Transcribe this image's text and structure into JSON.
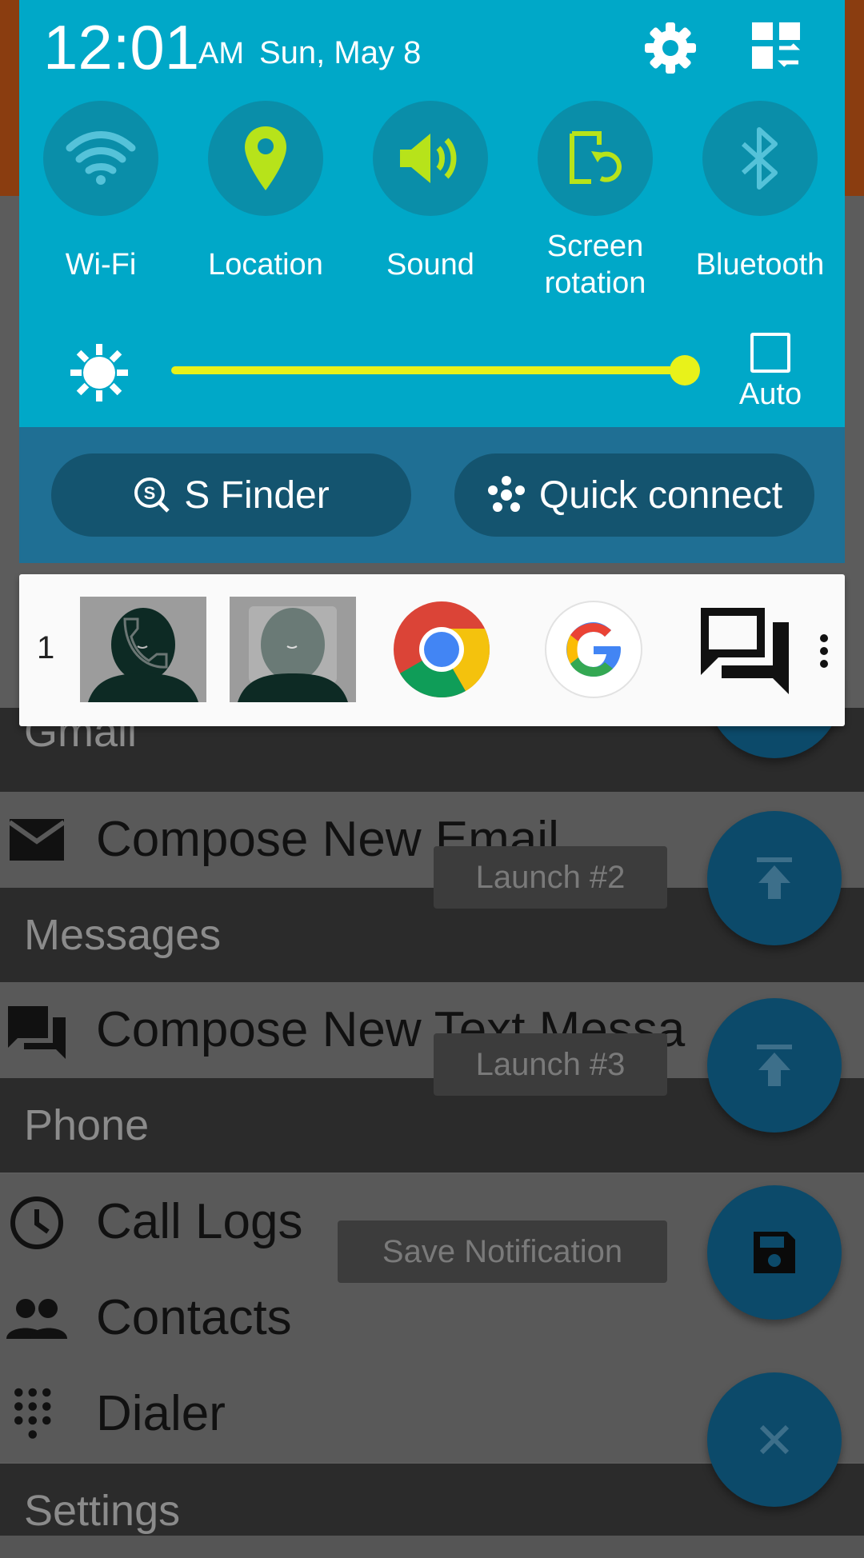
{
  "status": {
    "time": "12:01",
    "ampm": "AM",
    "date": "Sun, May 8"
  },
  "quick_toggles": [
    {
      "label": "Wi-Fi",
      "icon": "wifi-icon",
      "active": false
    },
    {
      "label": "Location",
      "icon": "location-pin-icon",
      "active": true
    },
    {
      "label": "Sound",
      "icon": "sound-icon",
      "active": true
    },
    {
      "label_line1": "Screen",
      "label_line2": "rotation",
      "icon": "screen-rotation-icon",
      "active": true
    },
    {
      "label": "Bluetooth",
      "icon": "bluetooth-icon",
      "active": false
    }
  ],
  "brightness": {
    "level": 0.93,
    "auto_label": "Auto"
  },
  "shade_buttons": {
    "s_finder": "S Finder",
    "quick_connect": "Quick connect"
  },
  "recent_apps": {
    "count": "1",
    "apps": [
      "contact-call-icon",
      "contact-icon",
      "chrome-icon",
      "google-icon",
      "messages-icon"
    ]
  },
  "app": {
    "partial_header": "Gmail",
    "compose_email": "Compose New Email",
    "messages_header": "Messages",
    "compose_text": "Compose New Text Messa",
    "phone_header": "Phone",
    "call_logs": "Call Logs",
    "contacts": "Contacts",
    "dialer": "Dialer",
    "settings_header": "Settings",
    "launch2": "Launch #2",
    "launch3": "Launch #3",
    "save_notification": "Save Notification"
  },
  "colors": {
    "shade": "#00a8c8",
    "accent_active": "#b7e31a",
    "fab": "#0c4a6a"
  }
}
